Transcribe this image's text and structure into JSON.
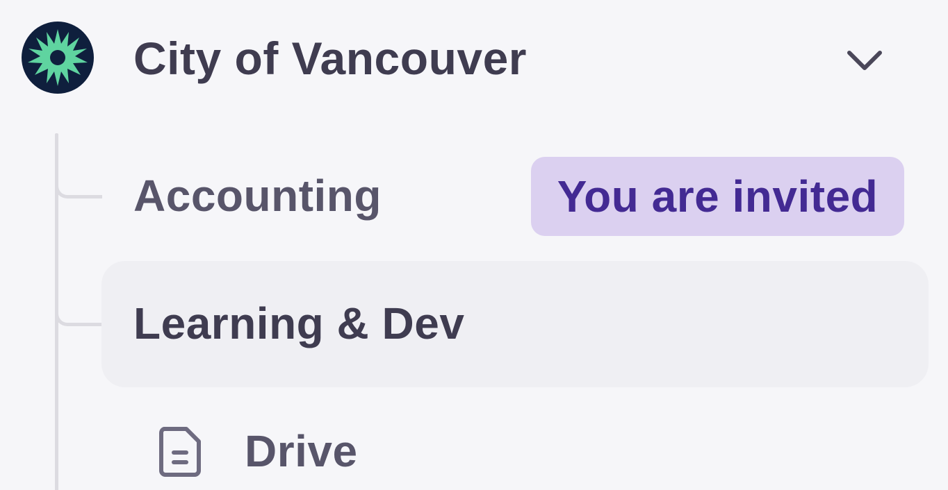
{
  "org": {
    "name": "City of Vancouver",
    "logo_icon": "starburst-icon",
    "logo_bg": "#0f1f3d",
    "logo_fg": "#5fd4a0",
    "expand_icon": "chevron-down-icon"
  },
  "teams": [
    {
      "label": "Accounting",
      "badge": "You are invited",
      "selected": false
    },
    {
      "label": "Learning & Dev",
      "selected": true
    }
  ],
  "sub_items": [
    {
      "label": "Drive",
      "icon": "document-icon"
    }
  ],
  "colors": {
    "background": "#f6f6f9",
    "selected_row": "#efeff3",
    "badge_bg": "#dbd0f0",
    "badge_text": "#432a93",
    "tree_line": "#dcdbe1"
  }
}
